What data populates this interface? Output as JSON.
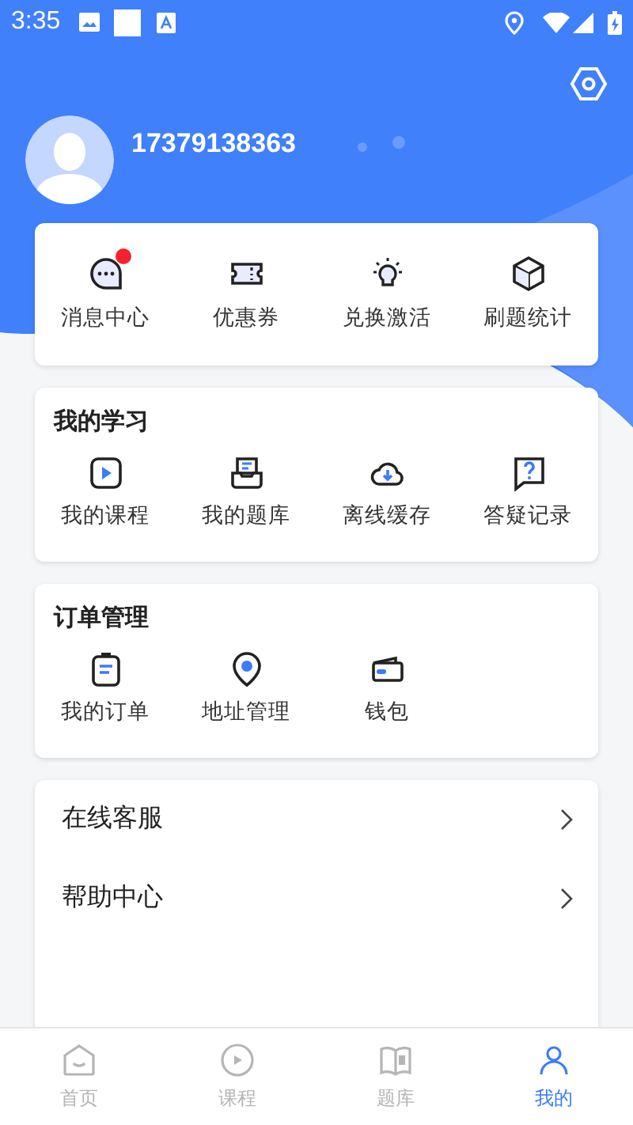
{
  "status_bar": {
    "time": "3:35"
  },
  "profile": {
    "phone": "17379138363"
  },
  "quick_actions": [
    {
      "label": "消息中心",
      "kind": "message",
      "badge": true
    },
    {
      "label": "优惠券",
      "kind": "coupon",
      "badge": false
    },
    {
      "label": "兑换激活",
      "kind": "bulb",
      "badge": false
    },
    {
      "label": "刷题统计",
      "kind": "cube",
      "badge": false
    }
  ],
  "sections": [
    {
      "title": "我的学习",
      "items": [
        {
          "label": "我的课程",
          "kind": "play"
        },
        {
          "label": "我的题库",
          "kind": "tray"
        },
        {
          "label": "离线缓存",
          "kind": "cloud"
        },
        {
          "label": "答疑记录",
          "kind": "question"
        }
      ]
    },
    {
      "title": "订单管理",
      "items": [
        {
          "label": "我的订单",
          "kind": "clipboard"
        },
        {
          "label": "地址管理",
          "kind": "pin"
        },
        {
          "label": "钱包",
          "kind": "wallet"
        }
      ]
    }
  ],
  "menu": [
    {
      "label": "在线客服"
    },
    {
      "label": "帮助中心"
    }
  ],
  "bottom_nav": [
    {
      "label": "首页",
      "kind": "home",
      "selected": false
    },
    {
      "label": "课程",
      "kind": "play",
      "selected": false
    },
    {
      "label": "题库",
      "kind": "book",
      "selected": false
    },
    {
      "label": "我的",
      "kind": "me",
      "selected": true
    }
  ]
}
